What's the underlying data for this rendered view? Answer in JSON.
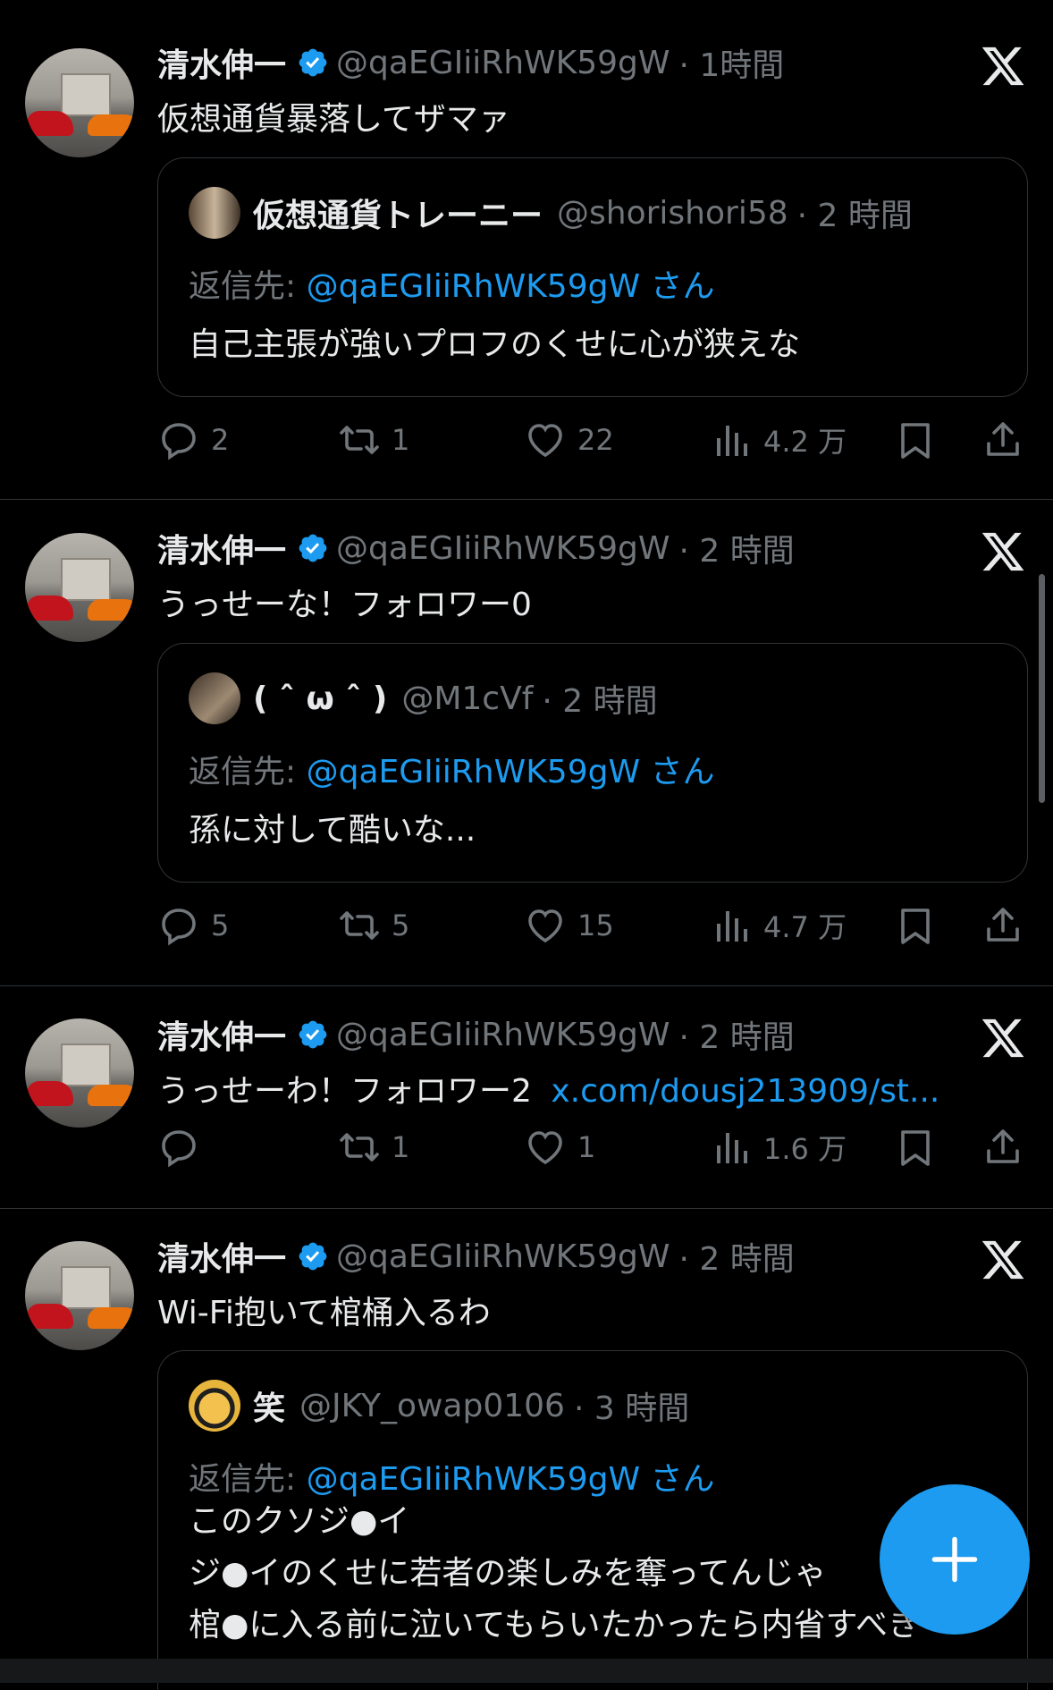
{
  "tweets": [
    {
      "name": "清水伸一",
      "handle": "@qaEGIiiRhWK59gW",
      "time": "· 1時間",
      "text": "仮想通貨暴落してザマァ",
      "quote": {
        "name": "仮想通貨トレーニー",
        "handle": "@shorishori58",
        "time": "· 2 時間",
        "reply_prefix": "返信先:",
        "reply_to": "@qaEGIiiRhWK59gW さん",
        "lines": [
          "自己主張が強いプロフのくせに心が狭えな"
        ]
      },
      "replies": "2",
      "retweets": "1",
      "likes": "22",
      "views": "4.2 万"
    },
    {
      "name": "清水伸一",
      "handle": "@qaEGIiiRhWK59gW",
      "time": "· 2 時間",
      "text": "うっせーな！フォロワー0",
      "quote": {
        "name": "( ˆ ω ˆ )",
        "handle": "@M1cVf",
        "time": "· 2 時間",
        "reply_prefix": "返信先:",
        "reply_to": "@qaEGIiiRhWK59gW さん",
        "lines": [
          "孫に対して酷いな..."
        ]
      },
      "replies": "5",
      "retweets": "5",
      "likes": "15",
      "views": "4.7 万"
    },
    {
      "name": "清水伸一",
      "handle": "@qaEGIiiRhWK59gW",
      "time": "· 2 時間",
      "text": "うっせーわ！フォロワー2",
      "link": "x.com/dousj213909/st...",
      "replies": "",
      "retweets": "1",
      "likes": "1",
      "views": "1.6 万"
    },
    {
      "name": "清水伸一",
      "handle": "@qaEGIiiRhWK59gW",
      "time": "· 2 時間",
      "text": "Wi-Fi抱いて棺桶入るわ",
      "quote": {
        "name": "笑",
        "handle": "@JKY_owap0106",
        "time": "· 3 時間",
        "reply_prefix": "返信先:",
        "reply_to": "@qaEGIiiRhWK59gW さん",
        "lines": [
          "このクソジ●イ",
          "ジ●イのくせに若者の楽しみを奪ってんじゃ",
          "棺●に入る前に泣いてもらいたかったら内省すべき"
        ]
      }
    }
  ],
  "colors": {
    "background": "#000000",
    "text": "#e7e9ea",
    "muted": "#71767b",
    "accent": "#1d9bf0",
    "border": "#2f3336"
  },
  "icons": [
    "verified-badge-icon",
    "x-logo-icon",
    "reply-icon",
    "retweet-icon",
    "like-icon",
    "views-icon",
    "bookmark-icon",
    "share-icon",
    "compose-plus-icon"
  ]
}
